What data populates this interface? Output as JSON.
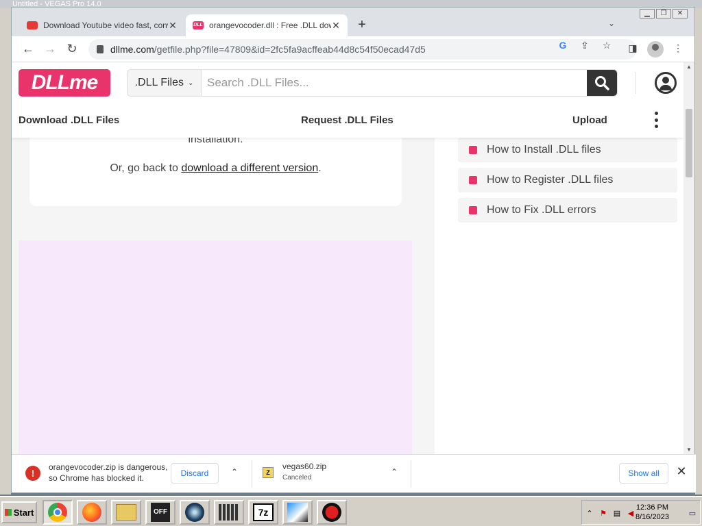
{
  "background_window": {
    "title": "Untitled - VEGAS Pro 14.0"
  },
  "tabs": [
    {
      "title": "Download Youtube video fast, conve",
      "active": false
    },
    {
      "title": "orangevocoder.dll : Free .DLL downl",
      "active": true
    }
  ],
  "toolbar": {
    "url_host": "dllme.com",
    "url_path": "/getfile.php?file=47809&id=2fc5fa9acffeab44d8c54f50ecad47d5"
  },
  "site": {
    "logo": "DLLme",
    "search_category": ".DLL Files",
    "search_placeholder": "Search .DLL Files...",
    "nav": [
      "Download .DLL Files",
      "Request .DLL Files",
      "Upload"
    ],
    "card_text_1": "installation.",
    "card_text_2_prefix": "Or, go back to",
    "card_link": "download a different version",
    "card_text_2_suffix": ".",
    "side_links": [
      "How to Install .DLL files",
      "How to Register .DLL files",
      "How to Fix .DLL errors"
    ]
  },
  "downloads": {
    "warn_line1": "orangevocoder.zip is dangerous,",
    "warn_line2": "so Chrome has blocked it.",
    "discard": "Discard",
    "file2_name": "vegas60.zip",
    "file2_status": "Canceled",
    "zip_label": "Z",
    "show_all": "Show all"
  },
  "taskbar": {
    "start": "Start",
    "time": "12:36 PM",
    "date": "8/16/2023"
  },
  "colors": {
    "brand": "#e8336b",
    "ad_bg": "#f7e9fb",
    "link_blue": "#1a73e8",
    "danger": "#d93025"
  }
}
